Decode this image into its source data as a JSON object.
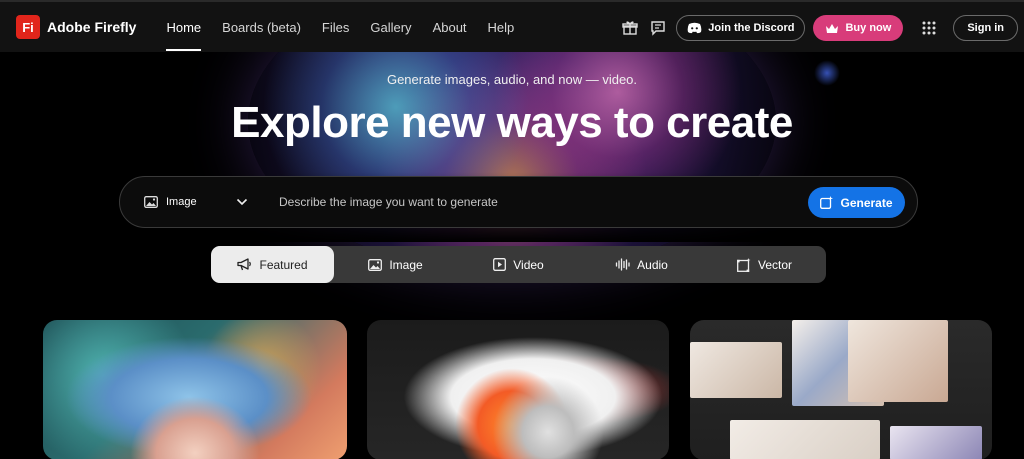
{
  "brand": {
    "logo_text": "Fi",
    "name": "Adobe Firefly"
  },
  "nav": {
    "links": [
      {
        "label": "Home",
        "active": true
      },
      {
        "label": "Boards (beta)",
        "active": false
      },
      {
        "label": "Files",
        "active": false
      },
      {
        "label": "Gallery",
        "active": false
      },
      {
        "label": "About",
        "active": false
      },
      {
        "label": "Help",
        "active": false
      }
    ],
    "discord_label": "Join the Discord",
    "buy_label": "Buy now",
    "signin_label": "Sign in"
  },
  "hero": {
    "subtitle": "Generate images, audio, and now — video.",
    "title": "Explore new ways to create"
  },
  "search": {
    "type_label": "Image",
    "placeholder": "Describe the image you want to generate",
    "value": "",
    "generate_label": "Generate"
  },
  "tabs": [
    {
      "label": "Featured",
      "icon": "megaphone-icon",
      "active": true
    },
    {
      "label": "Image",
      "icon": "image-icon",
      "active": false
    },
    {
      "label": "Video",
      "icon": "video-icon",
      "active": false
    },
    {
      "label": "Audio",
      "icon": "audio-wave-icon",
      "active": false
    },
    {
      "label": "Vector",
      "icon": "vector-icon",
      "active": false
    }
  ],
  "colors": {
    "brand_red": "#e1251b",
    "generate_blue": "#1473e6",
    "buy_pink": "#d83c7a",
    "nav_bg": "#121212"
  }
}
